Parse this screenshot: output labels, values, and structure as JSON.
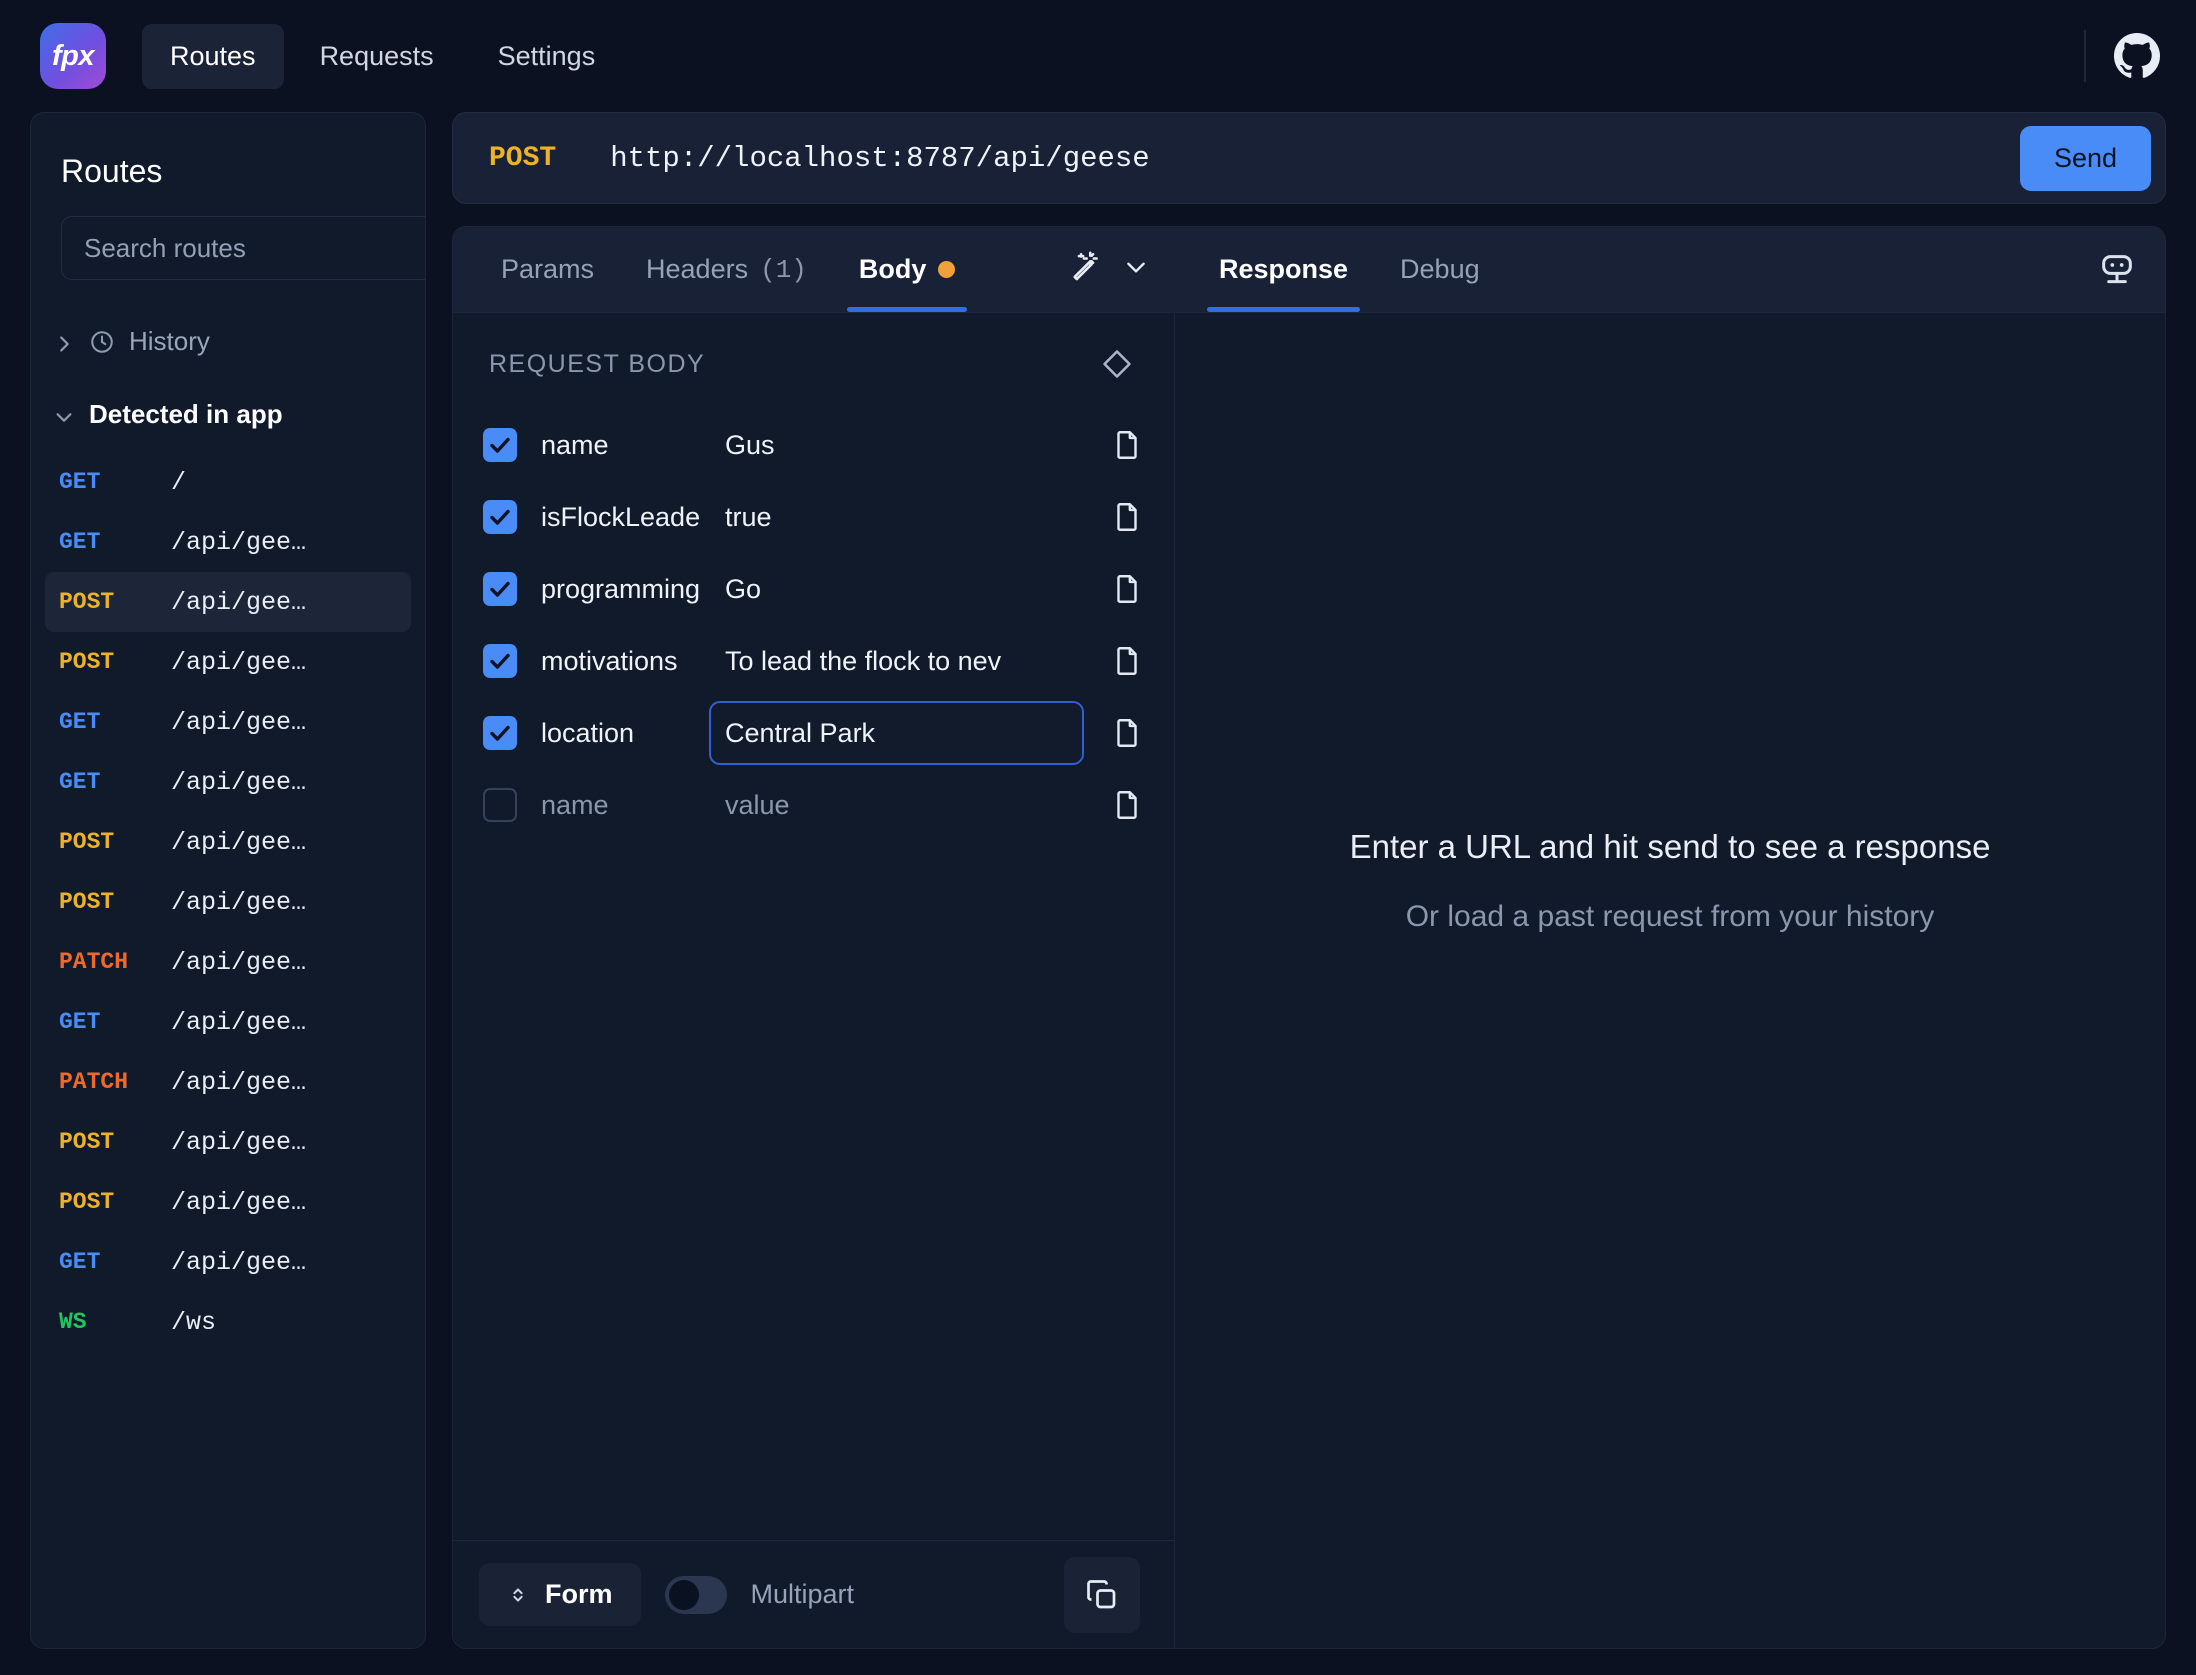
{
  "app": {
    "logo_text": "fpx",
    "nav": [
      {
        "label": "Routes",
        "active": true
      },
      {
        "label": "Requests",
        "active": false
      },
      {
        "label": "Settings",
        "active": false
      }
    ],
    "github_icon": "github-icon"
  },
  "sidebar": {
    "title": "Routes",
    "search_placeholder": "Search routes",
    "search_value": "",
    "add_label": "+",
    "groups": [
      {
        "label": "History",
        "expanded": false,
        "icon": "clock-icon"
      },
      {
        "label": "Detected in app",
        "expanded": true
      }
    ],
    "routes": [
      {
        "method": "GET",
        "path": "/"
      },
      {
        "method": "GET",
        "path": "/api/gee…"
      },
      {
        "method": "POST",
        "path": "/api/gee…",
        "selected": true
      },
      {
        "method": "POST",
        "path": "/api/gee…"
      },
      {
        "method": "GET",
        "path": "/api/gee…"
      },
      {
        "method": "GET",
        "path": "/api/gee…"
      },
      {
        "method": "POST",
        "path": "/api/gee…"
      },
      {
        "method": "POST",
        "path": "/api/gee…"
      },
      {
        "method": "PATCH",
        "path": "/api/gee…"
      },
      {
        "method": "GET",
        "path": "/api/gee…"
      },
      {
        "method": "PATCH",
        "path": "/api/gee…"
      },
      {
        "method": "POST",
        "path": "/api/gee…"
      },
      {
        "method": "POST",
        "path": "/api/gee…"
      },
      {
        "method": "GET",
        "path": "/api/gee…"
      },
      {
        "method": "WS",
        "path": "/ws"
      }
    ]
  },
  "urlbar": {
    "method": "POST",
    "url": "http://localhost:8787/api/geese",
    "url_placeholder": "Enter a URL",
    "send_label": "Send"
  },
  "tabs": {
    "left": [
      {
        "label": "Params",
        "active": false
      },
      {
        "label": "Headers",
        "count": "(1)",
        "active": false
      },
      {
        "label": "Body",
        "active": true,
        "dot": true
      }
    ],
    "right": [
      {
        "label": "Response",
        "active": true
      },
      {
        "label": "Debug",
        "active": false
      }
    ],
    "wand_icon": "magic-wand-icon",
    "wand_chevron": "chevron-down-icon",
    "bot_icon": "bot-icon"
  },
  "request_body": {
    "heading": "REQUEST BODY",
    "clear_icon": "eraser-icon",
    "rows": [
      {
        "enabled": true,
        "key": "name",
        "value": "Gus",
        "focused": false
      },
      {
        "enabled": true,
        "key": "isFlockLeade",
        "value": "true",
        "focused": false
      },
      {
        "enabled": true,
        "key": "programming",
        "value": "Go",
        "focused": false
      },
      {
        "enabled": true,
        "key": "motivations",
        "value": "To lead the flock to nev",
        "focused": false
      },
      {
        "enabled": true,
        "key": "location",
        "value": "Central Park",
        "focused": true
      },
      {
        "enabled": false,
        "key": "name",
        "value": "value",
        "focused": false,
        "placeholder": true
      }
    ],
    "footer": {
      "form_label": "Form",
      "multipart_label": "Multipart",
      "multipart_on": false,
      "copy_icon": "copy-icon"
    }
  },
  "response": {
    "empty_title": "Enter a URL and hit send to see a response",
    "empty_subtitle": "Or load a past request from your history"
  },
  "colors": {
    "accent_blue": "#4a8cf7",
    "method_get": "#4a8cf7",
    "method_post": "#ecb228",
    "method_patch": "#ef6a2a",
    "method_ws": "#22c55e",
    "dot_orange": "#f0a13a",
    "bg": "#0b1120",
    "panel": "#111a2b"
  }
}
